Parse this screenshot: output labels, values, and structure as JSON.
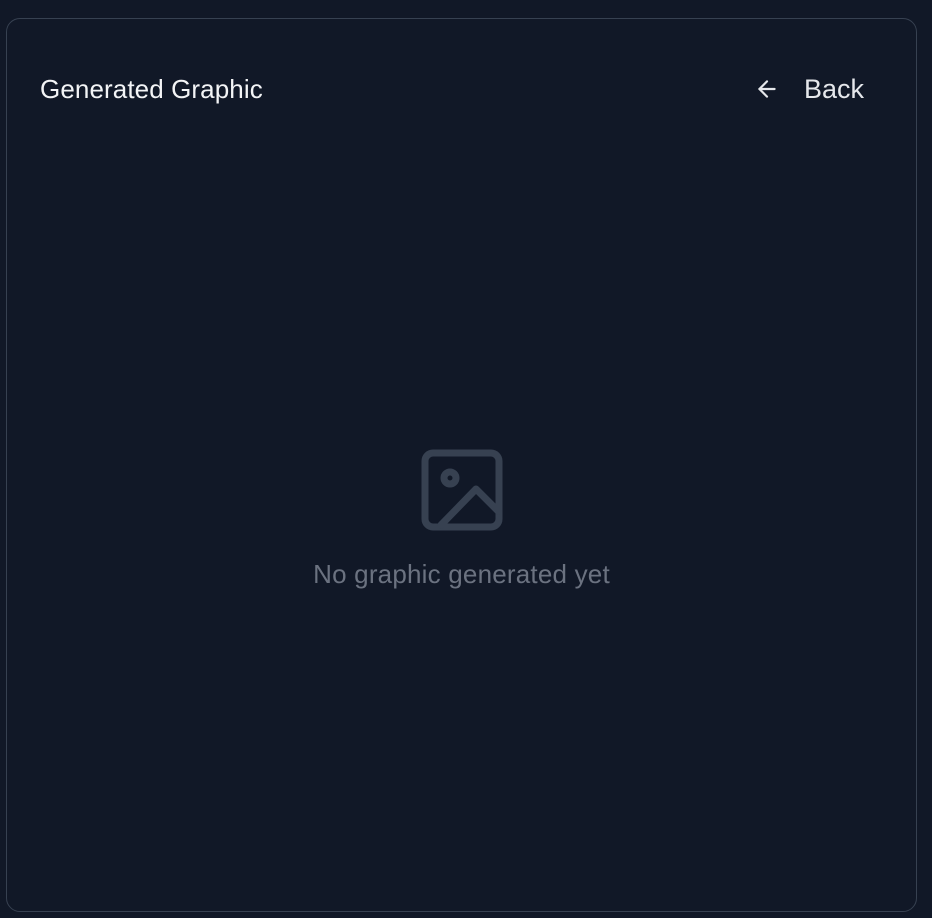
{
  "panel": {
    "title": "Generated Graphic",
    "back_label": "Back",
    "back_icon": "arrow-left-icon"
  },
  "empty_state": {
    "icon": "image-icon",
    "message": "No graphic generated yet"
  },
  "colors": {
    "background": "#111827",
    "border": "#374151",
    "title_text": "#f3f4f6",
    "muted_text": "#6b7280",
    "icon_muted": "#374151"
  }
}
